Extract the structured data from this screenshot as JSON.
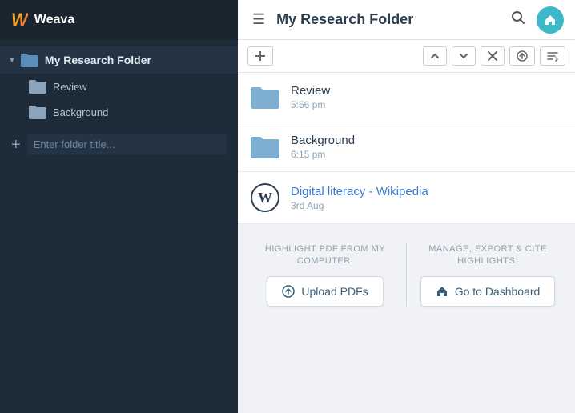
{
  "app": {
    "name": "Weava",
    "logo_letter": "W"
  },
  "sidebar": {
    "root_folder": "My Research Folder",
    "children": [
      {
        "label": "Review"
      },
      {
        "label": "Background"
      }
    ],
    "add_placeholder": "Enter folder title..."
  },
  "header": {
    "title": "My Research Folder",
    "hamburger_icon": "☰",
    "search_icon": "🔍",
    "home_icon": "⌂"
  },
  "toolbar": {
    "add_icon": "+",
    "up_icon": "↑",
    "down_icon": "↓",
    "close_icon": "✕",
    "upload_icon": "↑",
    "sort_icon": "≡↓"
  },
  "list": {
    "items": [
      {
        "type": "folder",
        "name": "Review",
        "date": "5:56 pm"
      },
      {
        "type": "folder",
        "name": "Background",
        "date": "6:15 pm"
      },
      {
        "type": "wiki",
        "name": "Digital literacy - Wikipedia",
        "date": "3rd Aug"
      }
    ]
  },
  "actions": {
    "left_label": "HIGHLIGHT PDF\nFROM MY COMPUTER:",
    "left_btn": "Upload PDFs",
    "right_label": "MANAGE, EXPORT &\nCITE HIGHLIGHTS:",
    "right_btn": "Go to Dashboard"
  }
}
